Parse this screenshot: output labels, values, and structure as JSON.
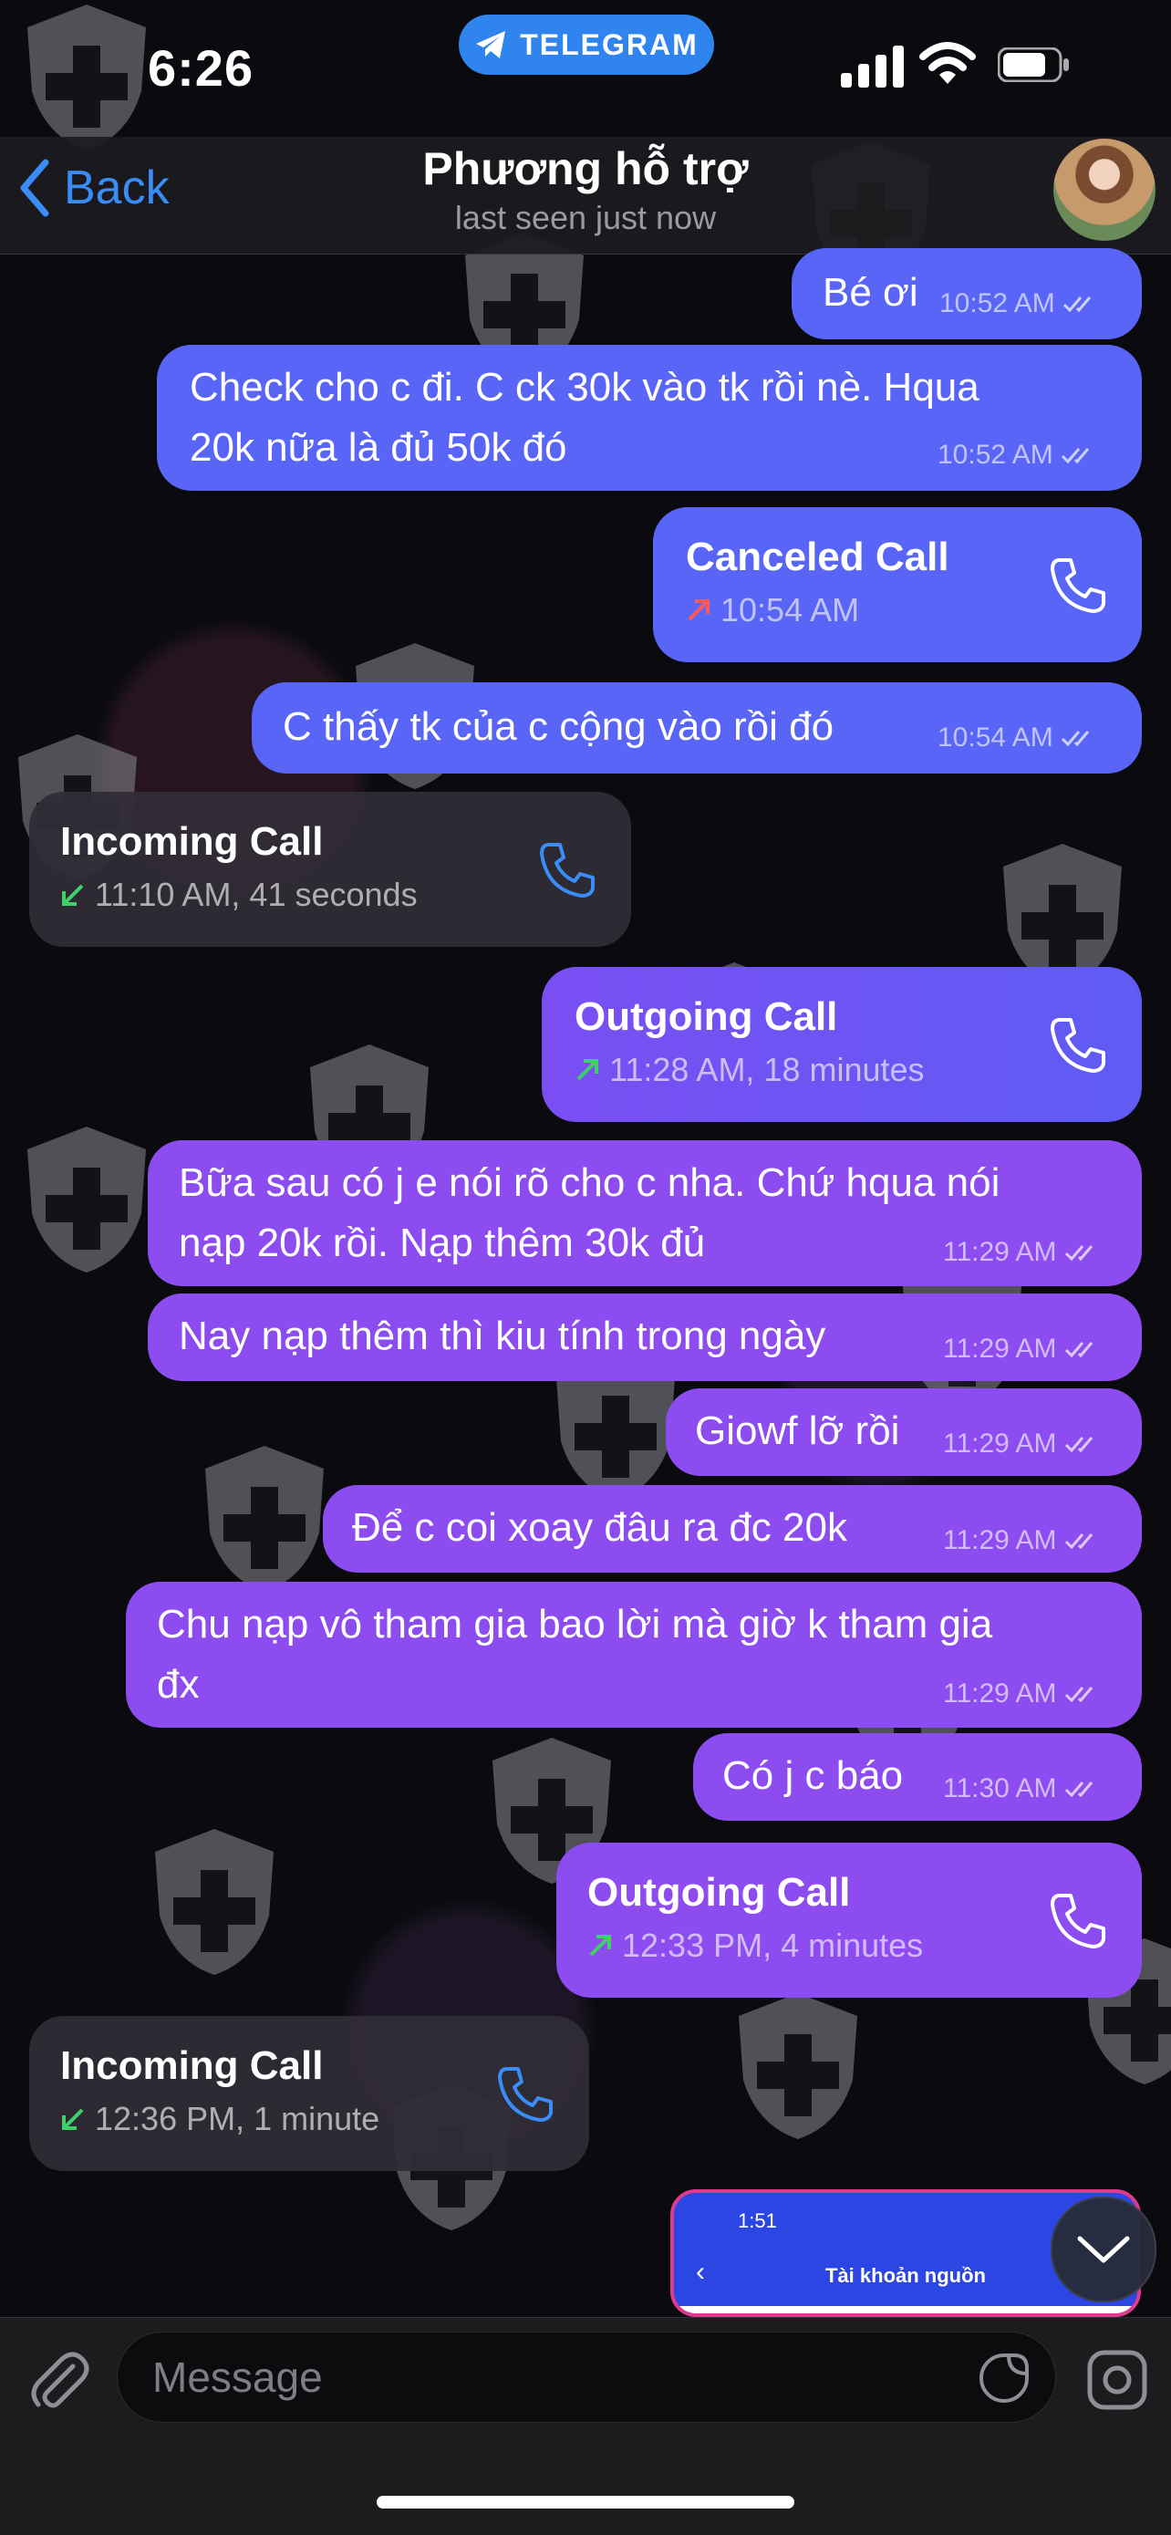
{
  "status_bar": {
    "time": "6:26",
    "app_pill": "TELEGRAM"
  },
  "header": {
    "back_label": "Back",
    "contact_name": "Phương hỗ trợ",
    "last_seen": "last seen just now"
  },
  "messages": [
    {
      "kind": "text",
      "lines": [
        "Bé ơi"
      ],
      "time": "10:52 AM"
    },
    {
      "kind": "text",
      "lines": [
        "Check cho c đi. C ck 30k vào tk rồi nè. Hqua",
        "20k nữa là đủ 50k đó"
      ],
      "time": "10:52 AM"
    },
    {
      "kind": "call",
      "title": "Canceled Call",
      "detail": "10:54 AM"
    },
    {
      "kind": "text",
      "lines": [
        "C thấy tk của c cộng vào rồi đó"
      ],
      "time": "10:54 AM"
    },
    {
      "kind": "call_in",
      "title": "Incoming Call",
      "detail": "11:10 AM, 41 seconds"
    },
    {
      "kind": "call",
      "title": "Outgoing Call",
      "detail": "11:28 AM, 18 minutes"
    },
    {
      "kind": "text",
      "lines": [
        "Bữa sau có j e nói rõ cho c nha. Chứ hqua nói",
        "nạp 20k rồi. Nạp thêm 30k đủ"
      ],
      "time": "11:29 AM"
    },
    {
      "kind": "text",
      "lines": [
        "Nay nạp thêm thì kiu tính trong ngày"
      ],
      "time": "11:29 AM"
    },
    {
      "kind": "text",
      "lines": [
        "Giowf lỡ rồi"
      ],
      "time": "11:29 AM"
    },
    {
      "kind": "text",
      "lines": [
        "Để c coi xoay đâu ra đc 20k"
      ],
      "time": "11:29 AM"
    },
    {
      "kind": "text",
      "lines": [
        "Chu nạp vô tham gia bao lời mà giờ k tham gia",
        "đx"
      ],
      "time": "11:29 AM"
    },
    {
      "kind": "text",
      "lines": [
        "Có j c báo"
      ],
      "time": "11:30 AM"
    },
    {
      "kind": "call",
      "title": "Outgoing Call",
      "detail": "12:33 PM, 4 minutes"
    },
    {
      "kind": "call_in",
      "title": "Incoming Call",
      "detail": "12:36 PM, 1 minute"
    }
  ],
  "image_preview": {
    "time": "1:51",
    "title": "Tài khoản nguồn"
  },
  "composer": {
    "placeholder": "Message"
  },
  "colors": {
    "accent": "#3a8cf6",
    "outgoing": "#7a4ef2",
    "incoming": "#302c36",
    "pill": "#2f84ee"
  },
  "icons": [
    "telegram-icon",
    "signal-icon",
    "wifi-icon",
    "battery-icon",
    "back-chevron-icon",
    "phone-icon",
    "call-arrow-icon",
    "read-ticks-icon",
    "attach-icon",
    "sticker-icon",
    "camera-icon",
    "chevron-down-icon",
    "shield-watermark-icon"
  ]
}
